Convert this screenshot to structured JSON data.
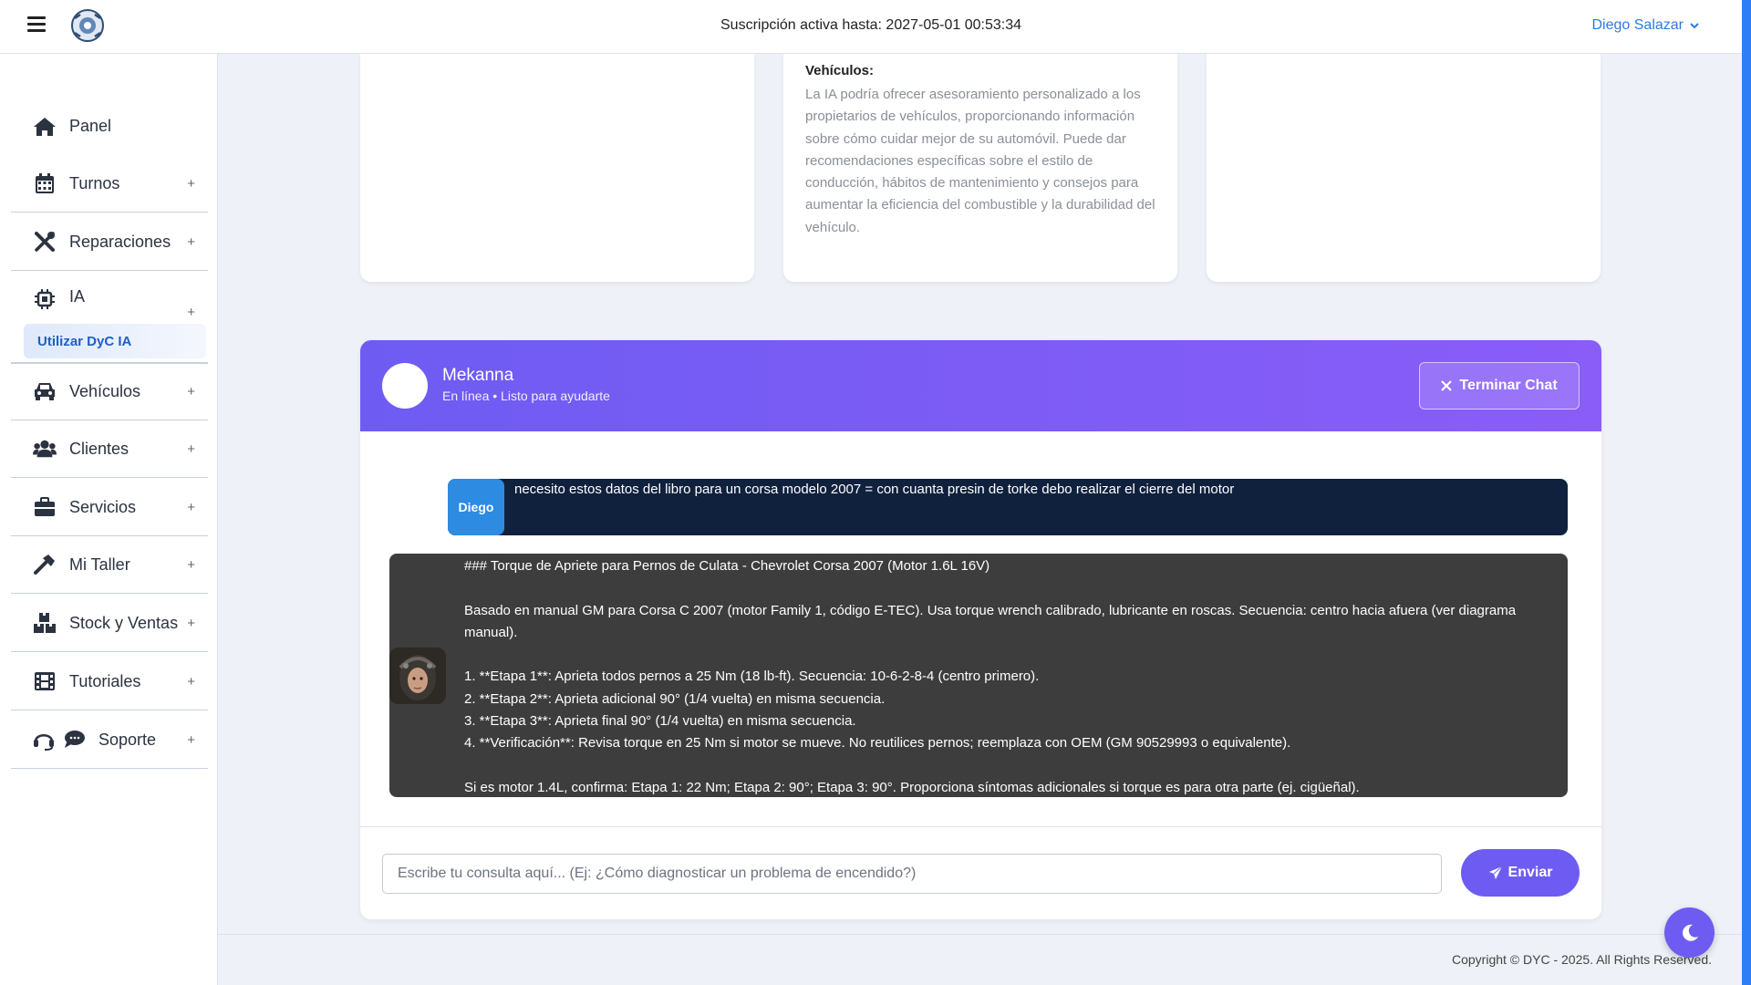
{
  "topbar": {
    "subscription": "Suscripción activa hasta: 2027-05-01 00:53:34",
    "user_name": "Diego Salazar",
    "icons": [
      "menu-icon",
      "logo",
      "chevron-down-icon"
    ]
  },
  "sidebar": {
    "items": [
      {
        "label": "Panel",
        "icon": "home-icon"
      },
      {
        "label": "Turnos",
        "icon": "calendar-icon",
        "expand": "+"
      },
      {
        "label": "Reparaciones",
        "icon": "tools-icon",
        "expand": "+"
      },
      {
        "label": "IA",
        "icon": "chip-icon",
        "expand": "+"
      },
      {
        "label": "Vehículos",
        "icon": "car-icon",
        "expand": "+"
      },
      {
        "label": "Clientes",
        "icon": "users-icon",
        "expand": "+"
      },
      {
        "label": "Servicios",
        "icon": "briefcase-icon",
        "expand": "+"
      },
      {
        "label": "Mi Taller",
        "icon": "hammer-icon",
        "expand": "+"
      },
      {
        "label": "Stock y Ventas",
        "icon": "boxes-icon",
        "expand": "+"
      },
      {
        "label": "Tutoriales",
        "icon": "film-icon",
        "expand": "+"
      },
      {
        "label": "Soporte",
        "icon": "headset-icon",
        "expand": "+"
      }
    ],
    "ia_subitem": "Utilizar DyC IA"
  },
  "cards": {
    "middle_title": "Vehículos:",
    "middle_text": "La IA podría ofrecer asesoramiento personalizado a los propietarios de vehículos, proporcionando información sobre cómo cuidar mejor de su automóvil. Puede dar recomendaciones específicas sobre el estilo de conducción, hábitos de mantenimiento y consejos para aumentar la eficiencia del combustible y la durabilidad del vehículo."
  },
  "chat": {
    "bot_name": "Mekanna",
    "bot_status": "En línea • Listo para ayudarte",
    "end_label": "Terminar Chat",
    "user_badge": "Diego",
    "user_message": "necesito estos datos del libro para un corsa modelo 2007 = con cuanta presin de torke debo realizar el cierre del motor",
    "bot_lines": [
      "### Torque de Apriete para Pernos de Culata - Chevrolet Corsa 2007 (Motor 1.6L 16V)",
      "",
      "Basado en manual GM para Corsa C 2007 (motor Family 1, código E-TEC). Usa torque wrench calibrado, lubricante en roscas. Secuencia: centro hacia afuera (ver diagrama manual).",
      "",
      "1. **Etapa 1**: Aprieta todos pernos a 25 Nm (18 lb-ft). Secuencia: 10-6-2-8-4 (centro primero).",
      "2. **Etapa 2**: Aprieta adicional 90° (1/4 vuelta) en misma secuencia.",
      "3. **Etapa 3**: Aprieta final 90° (1/4 vuelta) en misma secuencia.",
      "4. **Verificación**: Revisa torque en 25 Nm si motor se mueve. No reutilices pernos; reemplaza con OEM (GM 90529993 o equivalente).",
      "",
      "Si es motor 1.4L, confirma: Etapa 1: 22 Nm; Etapa 2: 90°; Etapa 3: 90°. Proporciona síntomas adicionales si torque es para otra parte (ej. cigüeñal)."
    ],
    "input_placeholder": "Escribe tu consulta aquí... (Ej: ¿Cómo diagnosticar un problema de encendido?)",
    "input_value": "",
    "send_label": "Enviar"
  },
  "footer": {
    "copyright": "Copyright © DYC - 2025. All Rights Reserved."
  },
  "colors": {
    "accent_purple": "#6e5cf2",
    "link_blue": "#2b7be4",
    "user_bubble": "#10213d",
    "bot_bubble": "#3d3d3d"
  }
}
